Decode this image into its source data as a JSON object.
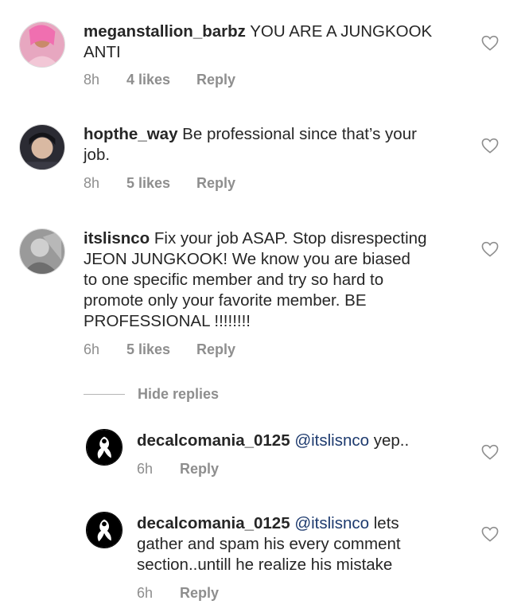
{
  "comments": [
    {
      "username": "meganstallion_barbz",
      "lines": [
        "YOU ARE A JUNGKOOK",
        "ANTI"
      ],
      "time": "8h",
      "likes": "4 likes",
      "reply": "Reply"
    },
    {
      "username": "hopthe_way",
      "lines": [
        "Be professional since that’s your",
        "job."
      ],
      "time": "8h",
      "likes": "5 likes",
      "reply": "Reply"
    },
    {
      "username": "itslisnco",
      "lines": [
        "Fix your job ASAP. Stop disrespecting",
        "JEON JUNGKOOK! We know you are biased",
        "to one specific member and try so hard to",
        "promote only your favorite member. BE",
        "PROFESSIONAL !!!!!!!!"
      ],
      "time": "6h",
      "likes": "5 likes",
      "reply": "Reply"
    }
  ],
  "hide_replies": "Hide replies",
  "replies": [
    {
      "username": "decalcomania_0125",
      "mention": "@itslisnco",
      "lines": [
        "yep..",
        ""
      ],
      "time": "6h",
      "reply": "Reply"
    },
    {
      "username": "decalcomania_0125",
      "mention": "@itslisnco",
      "lines": [
        "lets",
        "gather and spam his every comment",
        "section..untill he realize his mistake"
      ],
      "time": "6h",
      "reply": "Reply"
    }
  ],
  "icons": {
    "like": "heart-outline-icon"
  }
}
